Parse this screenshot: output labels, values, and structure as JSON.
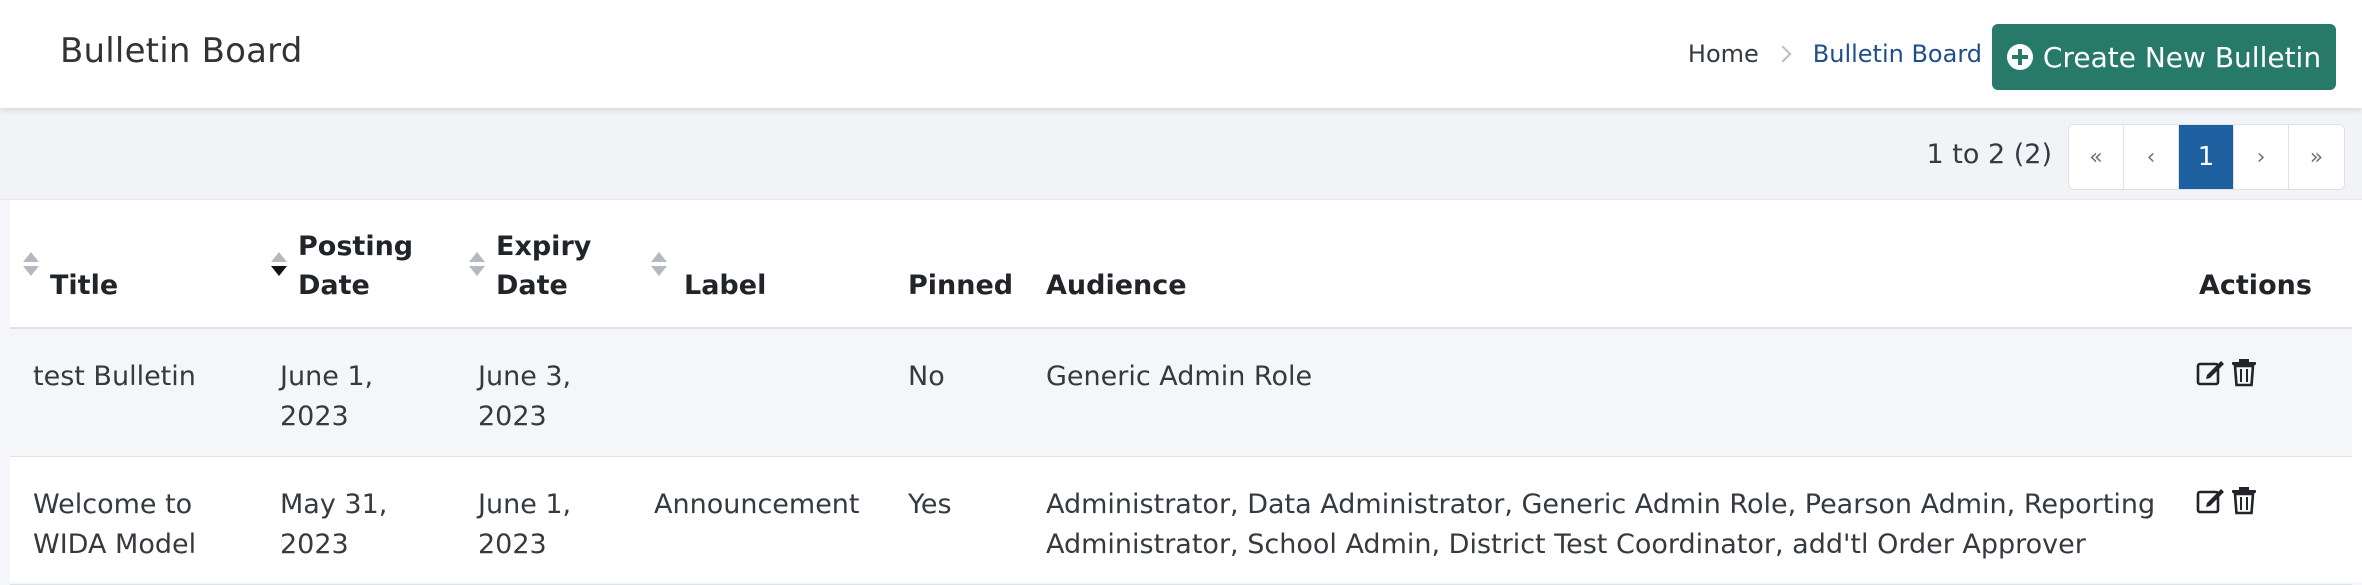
{
  "header": {
    "title": "Bulletin Board",
    "breadcrumb": {
      "home": "Home",
      "current": "Bulletin Board"
    },
    "create_button": "Create New Bulletin"
  },
  "pager": {
    "range": "1 to 2 (2)",
    "first": "«",
    "prev": "‹",
    "current": "1",
    "next": "›",
    "last": "»"
  },
  "table": {
    "columns": {
      "title": "Title",
      "posting_date": [
        "Posting",
        "Date"
      ],
      "expiry_date": [
        "Expiry",
        "Date"
      ],
      "label": "Label",
      "pinned": "Pinned",
      "audience": "Audience",
      "actions": "Actions"
    },
    "rows": [
      {
        "title": "test Bulletin",
        "posting_date": [
          "June 1,",
          "2023"
        ],
        "expiry_date": [
          "June 3,",
          "2023"
        ],
        "label": "",
        "pinned": "No",
        "audience": [
          "Generic Admin Role",
          ""
        ]
      },
      {
        "title": [
          "Welcome to",
          "WIDA Model"
        ],
        "posting_date": [
          "May 31,",
          "2023"
        ],
        "expiry_date": [
          "June 1,",
          "2023"
        ],
        "label": "Announcement",
        "pinned": "Yes",
        "audience": [
          "Administrator, Data Administrator, Generic Admin Role, Pearson Admin, Reporting",
          "Administrator, School Admin, District Test Coordinator, add'tl Order Approver"
        ]
      }
    ]
  },
  "icons": {
    "create": "plus-circle-icon",
    "edit": "edit-icon",
    "delete": "trash-icon"
  },
  "colors": {
    "primary_button": "#277a6a",
    "active_page": "#1e5fa0",
    "breadcrumb_current": "#1e4f8a"
  }
}
